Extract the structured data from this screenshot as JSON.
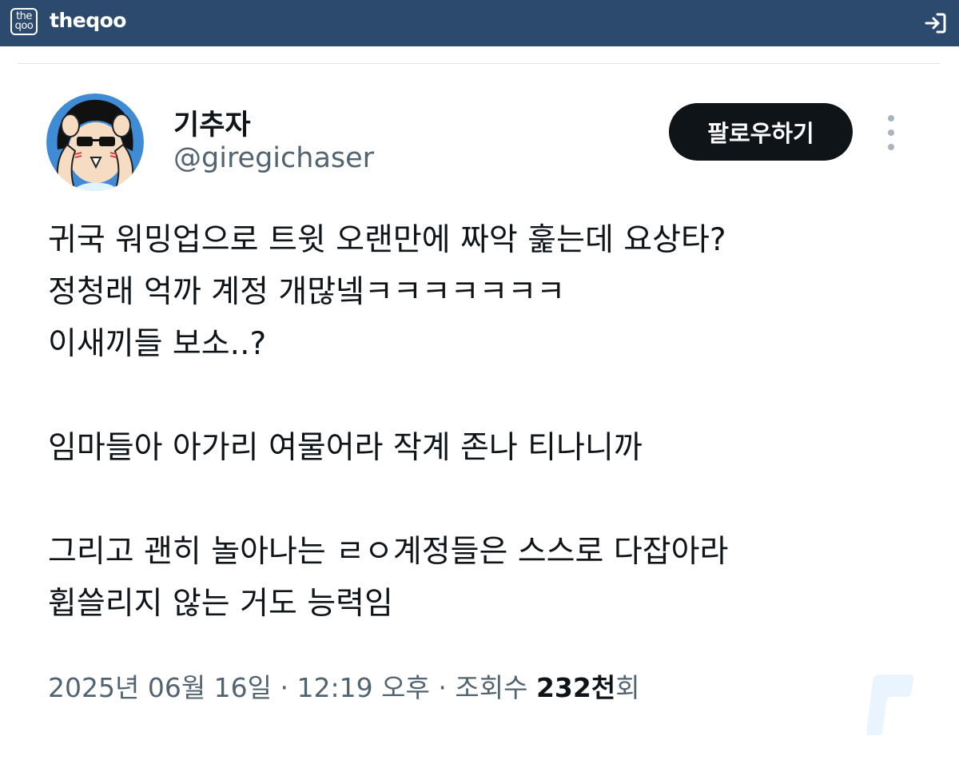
{
  "site": {
    "logo_top": "the",
    "logo_bottom": "qoo",
    "name": "theqoo",
    "login_icon": "login-icon",
    "bar_color": "#2c4a6e"
  },
  "tweet": {
    "display_name": "기추자",
    "handle": "@giregichaser",
    "follow_label": "팔로우하기",
    "more_icon": "more-vertical-icon",
    "lines": [
      "귀국 워밍업으로 트윗 오랜만에 짜악 훑는데 요상타?",
      "정청래 억까 계정 개많넼ㅋㅋㅋㅋㅋㅋㅋ",
      "이새끼들 보소..?",
      "",
      "임마들아 아가리 여물어라 작계 존나 티나니까",
      "",
      "그리고 괜히 놀아나는 ㄹㅇ계정들은 스스로 다잡아라",
      "휩쓸리지 않는 거도 능력임"
    ],
    "date": "2025년 06월 16일",
    "separator": "·",
    "time": "12:19 오후",
    "views_label": "조회수",
    "views_count": "232천",
    "views_suffix": "회"
  }
}
